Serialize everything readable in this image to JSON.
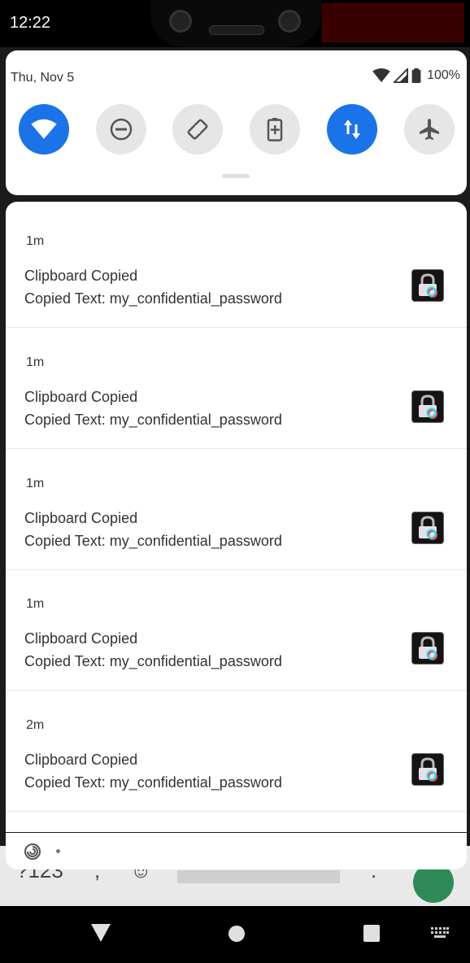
{
  "status_bar": {
    "time": "12:22"
  },
  "quick_settings": {
    "date": "Thu, Nov 5",
    "battery_percent": "100%",
    "tiles": [
      {
        "name": "wifi",
        "on": true
      },
      {
        "name": "do-not-disturb",
        "on": false
      },
      {
        "name": "auto-rotate",
        "on": false
      },
      {
        "name": "battery-saver",
        "on": false
      },
      {
        "name": "mobile-data",
        "on": true
      },
      {
        "name": "airplane-mode",
        "on": false
      }
    ],
    "accent_color": "#1a73e8"
  },
  "notifications": [
    {
      "time_ago": "1m",
      "title": "Clipboard Copied",
      "text": "Copied Text: my_confidential_password"
    },
    {
      "time_ago": "1m",
      "title": "Clipboard Copied",
      "text": "Copied Text: my_confidential_password"
    },
    {
      "time_ago": "1m",
      "title": "Clipboard Copied",
      "text": "Copied Text: my_confidential_password"
    },
    {
      "time_ago": "1m",
      "title": "Clipboard Copied",
      "text": "Copied Text: my_confidential_password"
    },
    {
      "time_ago": "2m",
      "title": "Clipboard Copied",
      "text": "Copied Text: my_confidential_password"
    }
  ],
  "icons": {
    "notification_app": "lock-clipboard-icon",
    "footer_app": "app-spiral-icon"
  }
}
